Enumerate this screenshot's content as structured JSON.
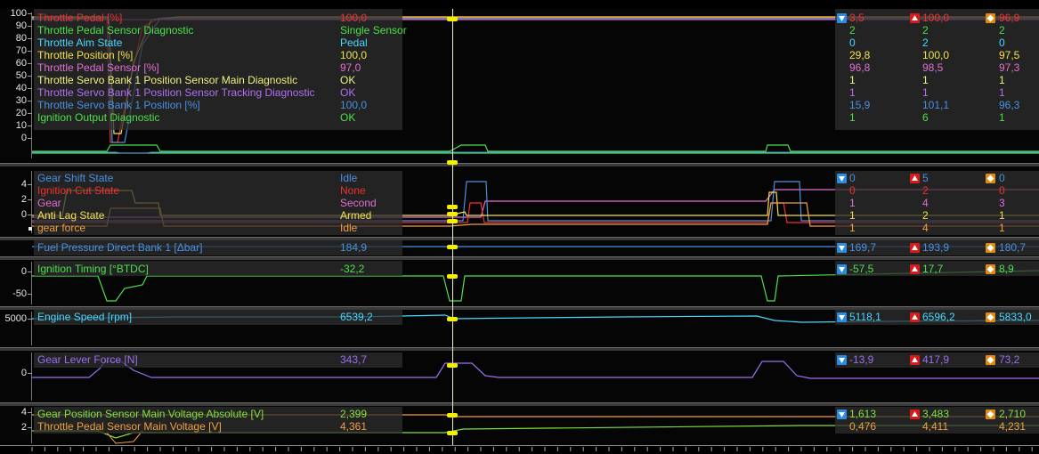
{
  "colors": {
    "red": "#f03030",
    "green": "#4ce04c",
    "cyan": "#48d8ff",
    "yellow": "#f0e050",
    "pink": "#e070d0",
    "lightyellow": "#f0f080",
    "violet": "#b070f0",
    "blue": "#4a90e0",
    "white": "#e8e8e8",
    "orange": "#f0a040",
    "lime": "#80e040",
    "purple": "#9a70f0"
  },
  "stat_icons": {
    "min": "down-triangle-icon",
    "max": "up-triangle-icon",
    "avg": "diamond-icon"
  },
  "panels": {
    "throttle": {
      "y_ticks": [
        "100",
        "90",
        "80",
        "70",
        "60",
        "50",
        "40",
        "30",
        "20",
        "10",
        "0"
      ],
      "channels": [
        {
          "label": "Throttle Pedal [%]",
          "value": "100,0",
          "min": "3,5",
          "max": "100,0",
          "avg": "96,9",
          "color": "red"
        },
        {
          "label": "Throttle Pedal Sensor Diagnostic",
          "value": "Single Sensor",
          "min": "2",
          "max": "2",
          "avg": "2",
          "color": "green"
        },
        {
          "label": "Throttle Aim State",
          "value": "Pedal",
          "min": "0",
          "max": "2",
          "avg": "0",
          "color": "cyan"
        },
        {
          "label": "Throttle Position [%]",
          "value": "100,0",
          "min": "29,8",
          "max": "100,0",
          "avg": "97,5",
          "color": "yellow"
        },
        {
          "label": "Throttle Pedal Sensor [%]",
          "value": "97,0",
          "min": "96,8",
          "max": "98,5",
          "avg": "97,3",
          "color": "pink"
        },
        {
          "label": "Throttle Servo Bank 1 Position Sensor Main Diagnostic",
          "value": "OK",
          "min": "1",
          "max": "1",
          "avg": "1",
          "color": "lightyellow"
        },
        {
          "label": "Throttle Servo Bank 1 Position Sensor Tracking Diagnostic",
          "value": "OK",
          "min": "1",
          "max": "1",
          "avg": "1",
          "color": "violet"
        },
        {
          "label": "Throttle Servo Bank 1 Position [%]",
          "value": "100,0",
          "min": "15,9",
          "max": "101,1",
          "avg": "96,3",
          "color": "blue"
        },
        {
          "label": "Ignition Output Diagnostic",
          "value": "OK",
          "min": "1",
          "max": "6",
          "avg": "1",
          "color": "green"
        }
      ]
    },
    "gear": {
      "y_ticks": [
        "4",
        "2",
        "0"
      ],
      "channels": [
        {
          "label": "Gear Shift State",
          "value": "Idle",
          "min": "0",
          "max": "5",
          "avg": "0",
          "color": "blue"
        },
        {
          "label": "Ignition Cut State",
          "value": "None",
          "min": "0",
          "max": "2",
          "avg": "0",
          "color": "red"
        },
        {
          "label": "Gear",
          "value": "Second",
          "min": "1",
          "max": "4",
          "avg": "3",
          "color": "pink"
        },
        {
          "label": "Anti Lag State",
          "value": "Armed",
          "min": "1",
          "max": "2",
          "avg": "1",
          "color": "yellow"
        },
        {
          "label": "gear force",
          "value": "Idle",
          "min": "1",
          "max": "4",
          "avg": "1",
          "color": "orange"
        }
      ]
    },
    "fuel": {
      "y_ticks": [],
      "channels": [
        {
          "label": "Fuel Pressure Direct Bank 1 [Δbar]",
          "value": "184,9",
          "min": "169,7",
          "max": "193,9",
          "avg": "180,7",
          "color": "blue"
        }
      ]
    },
    "ignition": {
      "y_ticks": [
        "0",
        "-50"
      ],
      "channels": [
        {
          "label": "Ignition Timing [°BTDC]",
          "value": "-32,2",
          "min": "-57,5",
          "max": "17,7",
          "avg": "8,9",
          "color": "green"
        }
      ]
    },
    "engine": {
      "y_ticks": [
        "5000"
      ],
      "channels": [
        {
          "label": "Engine Speed [rpm]",
          "value": "6539,2",
          "min": "5118,1",
          "max": "6596,2",
          "avg": "5833,0",
          "color": "cyan"
        }
      ]
    },
    "lever": {
      "y_ticks": [
        "0"
      ],
      "channels": [
        {
          "label": "Gear Lever Force [N]",
          "value": "343,7",
          "min": "-13,9",
          "max": "417,9",
          "avg": "73,2",
          "color": "purple"
        }
      ]
    },
    "voltage": {
      "y_ticks": [
        "4",
        "2"
      ],
      "channels": [
        {
          "label": "Gear Position Sensor Main Voltage Absolute [V]",
          "value": "2,399",
          "min": "1,613",
          "max": "3,483",
          "avg": "2,710",
          "color": "lime"
        },
        {
          "label": "Throttle Pedal Sensor Main Voltage [V]",
          "value": "4,361",
          "min": "0,476",
          "max": "4,411",
          "avg": "4,231",
          "color": "orange"
        }
      ]
    }
  }
}
